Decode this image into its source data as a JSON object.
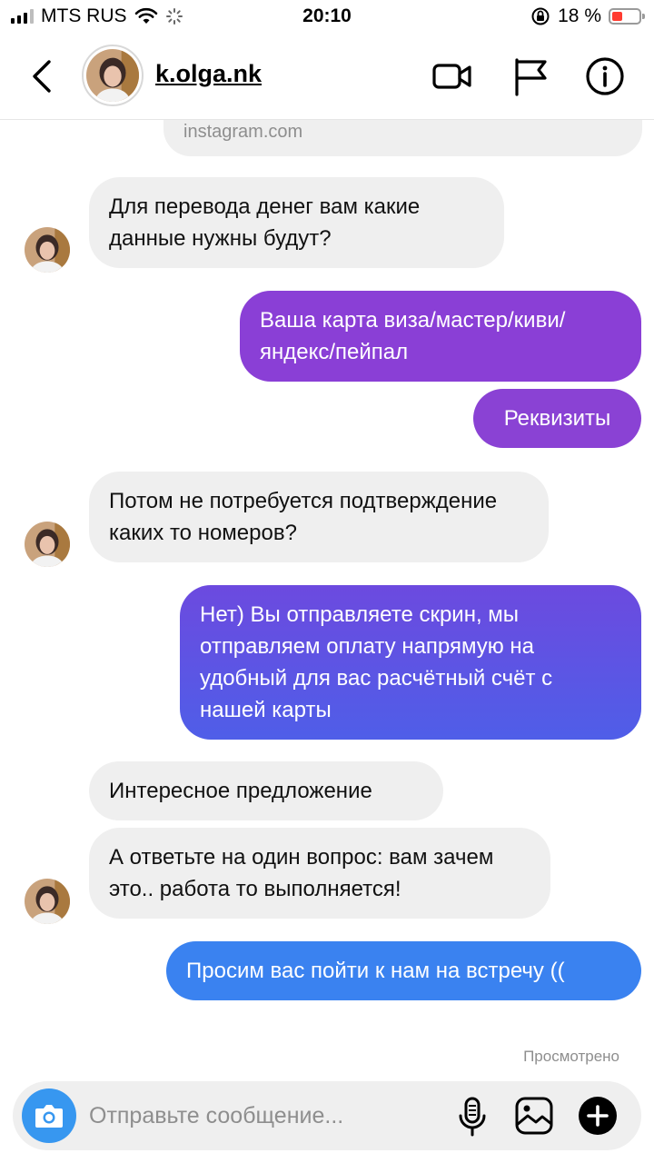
{
  "status_bar": {
    "carrier": "MTS RUS",
    "time": "20:10",
    "battery_percent": "18 %",
    "battery_level": 0.18
  },
  "header": {
    "username": "k.olga.nk",
    "icons": [
      "back-icon",
      "video-camera-icon",
      "flag-icon",
      "info-icon"
    ]
  },
  "chat": {
    "link_preview_domain": "instagram.com",
    "messages": [
      {
        "direction": "incoming",
        "text": "Для перевода денег вам какие данные нужны будут?"
      },
      {
        "direction": "outgoing",
        "text": "Ваша карта виза/мастер/киви/яндекс/пейпал"
      },
      {
        "direction": "outgoing",
        "text": "Реквизиты"
      },
      {
        "direction": "incoming",
        "text": "Потом не потребуется подтверждение каких то номеров?"
      },
      {
        "direction": "outgoing",
        "text": "Нет) Вы отправляете скрин, мы отправляем оплату напрямую на удобный для вас расчётный счёт с нашей карты"
      },
      {
        "direction": "incoming",
        "text": "Интересное предложение"
      },
      {
        "direction": "incoming",
        "text": "А ответьте на один вопрос: вам зачем это.. работа то выполняется!"
      },
      {
        "direction": "outgoing",
        "text": "Просим вас пойти к нам на встречу (("
      }
    ],
    "seen_label": "Просмотрено"
  },
  "composer": {
    "placeholder": "Отправьте сообщение...",
    "icons": [
      "camera-icon",
      "microphone-icon",
      "gallery-icon",
      "plus-icon"
    ]
  },
  "colors": {
    "incoming_bubble": "#efefef",
    "outgoing_purple": "#8a3fd6",
    "outgoing_indigo": "#5b53e0",
    "outgoing_blue": "#3a82f0",
    "camera_button": "#3797f0"
  }
}
